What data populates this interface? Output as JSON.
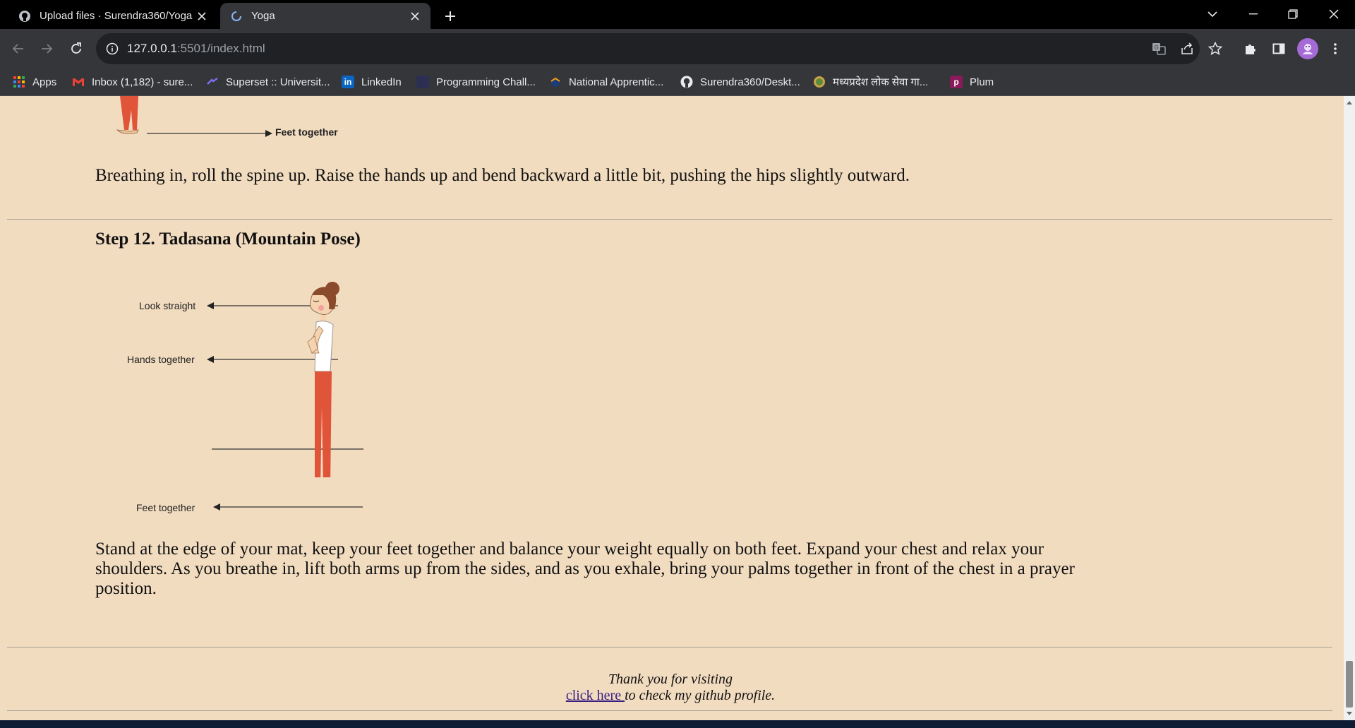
{
  "browser": {
    "tabs": [
      {
        "title": "Upload files · Surendra360/Yoga",
        "active": false
      },
      {
        "title": "Yoga",
        "active": true
      }
    ],
    "url_host": "127.0.0.1",
    "url_rest": ":5501/index.html",
    "bookmarks": [
      {
        "label": "Apps",
        "icon": "apps-grid-icon"
      },
      {
        "label": "Inbox (1,182) - sure...",
        "icon": "gmail-icon"
      },
      {
        "label": "Superset :: Universit...",
        "icon": "superset-icon"
      },
      {
        "label": "LinkedIn",
        "icon": "linkedin-icon"
      },
      {
        "label": "Programming Chall...",
        "icon": "challenge-icon"
      },
      {
        "label": "National Apprentic...",
        "icon": "apprentice-icon"
      },
      {
        "label": "Surendra360/Deskt...",
        "icon": "github-icon"
      },
      {
        "label": "मध्यप्रदेश लोक सेवा गा...",
        "icon": "mp-seal-icon"
      },
      {
        "label": "Plum",
        "icon": "plum-icon"
      }
    ]
  },
  "page": {
    "prev_step": {
      "figure_labels": {
        "feet": "Feet together"
      },
      "description": "Breathing in, roll the spine up. Raise the hands up and bend backward a little bit, pushing the hips slightly outward."
    },
    "step12": {
      "title": "Step 12. Tadasana (Mountain Pose)",
      "figure_labels": {
        "look": "Look straight",
        "hands": "Hands together",
        "feet": "Feet together"
      },
      "description": "Stand at the edge of your mat, keep your feet together and balance your weight equally on both feet. Expand your chest and relax your shoulders. As you breathe in, lift both arms up from the sides, and as you exhale, bring your palms together in front of the chest in a prayer position."
    },
    "footer": {
      "thanks": "Thank you for visiting",
      "link_text": "click here ",
      "link_suffix": "to check my github profile."
    }
  },
  "colors": {
    "page_bg": "#f2dcc0",
    "pants": "#e0553a",
    "hair": "#8b4a2b"
  }
}
